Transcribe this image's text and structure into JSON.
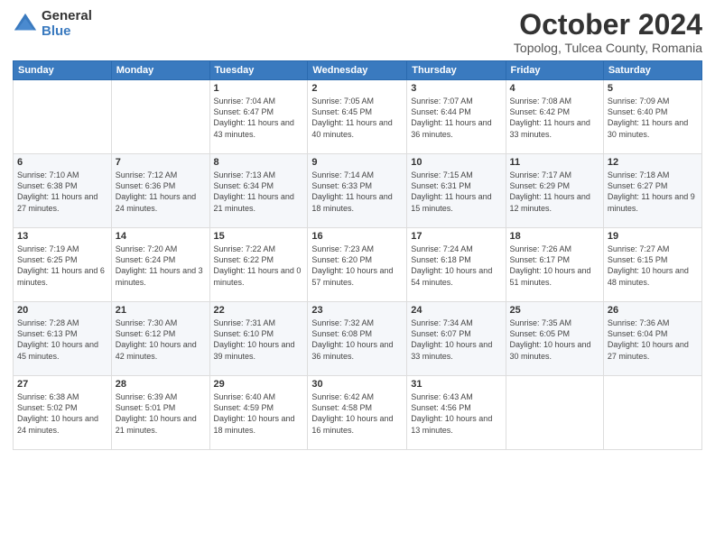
{
  "logo": {
    "general": "General",
    "blue": "Blue"
  },
  "header": {
    "month": "October 2024",
    "location": "Topolog, Tulcea County, Romania"
  },
  "weekdays": [
    "Sunday",
    "Monday",
    "Tuesday",
    "Wednesday",
    "Thursday",
    "Friday",
    "Saturday"
  ],
  "weeks": [
    [
      {
        "day": "",
        "info": ""
      },
      {
        "day": "",
        "info": ""
      },
      {
        "day": "1",
        "info": "Sunrise: 7:04 AM\nSunset: 6:47 PM\nDaylight: 11 hours and 43 minutes."
      },
      {
        "day": "2",
        "info": "Sunrise: 7:05 AM\nSunset: 6:45 PM\nDaylight: 11 hours and 40 minutes."
      },
      {
        "day": "3",
        "info": "Sunrise: 7:07 AM\nSunset: 6:44 PM\nDaylight: 11 hours and 36 minutes."
      },
      {
        "day": "4",
        "info": "Sunrise: 7:08 AM\nSunset: 6:42 PM\nDaylight: 11 hours and 33 minutes."
      },
      {
        "day": "5",
        "info": "Sunrise: 7:09 AM\nSunset: 6:40 PM\nDaylight: 11 hours and 30 minutes."
      }
    ],
    [
      {
        "day": "6",
        "info": "Sunrise: 7:10 AM\nSunset: 6:38 PM\nDaylight: 11 hours and 27 minutes."
      },
      {
        "day": "7",
        "info": "Sunrise: 7:12 AM\nSunset: 6:36 PM\nDaylight: 11 hours and 24 minutes."
      },
      {
        "day": "8",
        "info": "Sunrise: 7:13 AM\nSunset: 6:34 PM\nDaylight: 11 hours and 21 minutes."
      },
      {
        "day": "9",
        "info": "Sunrise: 7:14 AM\nSunset: 6:33 PM\nDaylight: 11 hours and 18 minutes."
      },
      {
        "day": "10",
        "info": "Sunrise: 7:15 AM\nSunset: 6:31 PM\nDaylight: 11 hours and 15 minutes."
      },
      {
        "day": "11",
        "info": "Sunrise: 7:17 AM\nSunset: 6:29 PM\nDaylight: 11 hours and 12 minutes."
      },
      {
        "day": "12",
        "info": "Sunrise: 7:18 AM\nSunset: 6:27 PM\nDaylight: 11 hours and 9 minutes."
      }
    ],
    [
      {
        "day": "13",
        "info": "Sunrise: 7:19 AM\nSunset: 6:25 PM\nDaylight: 11 hours and 6 minutes."
      },
      {
        "day": "14",
        "info": "Sunrise: 7:20 AM\nSunset: 6:24 PM\nDaylight: 11 hours and 3 minutes."
      },
      {
        "day": "15",
        "info": "Sunrise: 7:22 AM\nSunset: 6:22 PM\nDaylight: 11 hours and 0 minutes."
      },
      {
        "day": "16",
        "info": "Sunrise: 7:23 AM\nSunset: 6:20 PM\nDaylight: 10 hours and 57 minutes."
      },
      {
        "day": "17",
        "info": "Sunrise: 7:24 AM\nSunset: 6:18 PM\nDaylight: 10 hours and 54 minutes."
      },
      {
        "day": "18",
        "info": "Sunrise: 7:26 AM\nSunset: 6:17 PM\nDaylight: 10 hours and 51 minutes."
      },
      {
        "day": "19",
        "info": "Sunrise: 7:27 AM\nSunset: 6:15 PM\nDaylight: 10 hours and 48 minutes."
      }
    ],
    [
      {
        "day": "20",
        "info": "Sunrise: 7:28 AM\nSunset: 6:13 PM\nDaylight: 10 hours and 45 minutes."
      },
      {
        "day": "21",
        "info": "Sunrise: 7:30 AM\nSunset: 6:12 PM\nDaylight: 10 hours and 42 minutes."
      },
      {
        "day": "22",
        "info": "Sunrise: 7:31 AM\nSunset: 6:10 PM\nDaylight: 10 hours and 39 minutes."
      },
      {
        "day": "23",
        "info": "Sunrise: 7:32 AM\nSunset: 6:08 PM\nDaylight: 10 hours and 36 minutes."
      },
      {
        "day": "24",
        "info": "Sunrise: 7:34 AM\nSunset: 6:07 PM\nDaylight: 10 hours and 33 minutes."
      },
      {
        "day": "25",
        "info": "Sunrise: 7:35 AM\nSunset: 6:05 PM\nDaylight: 10 hours and 30 minutes."
      },
      {
        "day": "26",
        "info": "Sunrise: 7:36 AM\nSunset: 6:04 PM\nDaylight: 10 hours and 27 minutes."
      }
    ],
    [
      {
        "day": "27",
        "info": "Sunrise: 6:38 AM\nSunset: 5:02 PM\nDaylight: 10 hours and 24 minutes."
      },
      {
        "day": "28",
        "info": "Sunrise: 6:39 AM\nSunset: 5:01 PM\nDaylight: 10 hours and 21 minutes."
      },
      {
        "day": "29",
        "info": "Sunrise: 6:40 AM\nSunset: 4:59 PM\nDaylight: 10 hours and 18 minutes."
      },
      {
        "day": "30",
        "info": "Sunrise: 6:42 AM\nSunset: 4:58 PM\nDaylight: 10 hours and 16 minutes."
      },
      {
        "day": "31",
        "info": "Sunrise: 6:43 AM\nSunset: 4:56 PM\nDaylight: 10 hours and 13 minutes."
      },
      {
        "day": "",
        "info": ""
      },
      {
        "day": "",
        "info": ""
      }
    ]
  ]
}
